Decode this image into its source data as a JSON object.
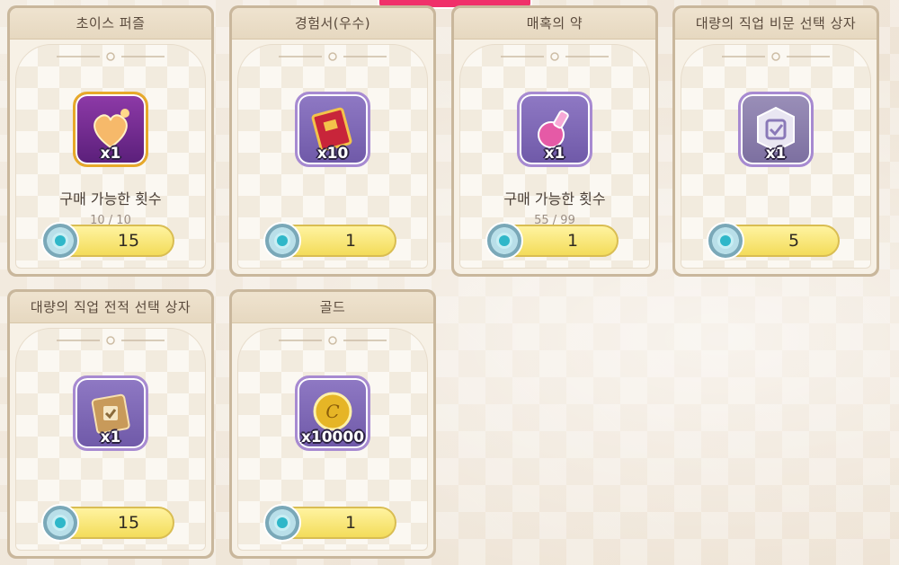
{
  "cards": [
    {
      "title": "초이스 퍼즐",
      "quantity": "x1",
      "limit_label": "구매 가능한 횟수",
      "limit_count": "10 / 10",
      "price": "15",
      "icon": "heart-puzzle-icon"
    },
    {
      "title": "경험서(우수)",
      "quantity": "x10",
      "limit_label": "",
      "limit_count": "",
      "price": "1",
      "icon": "red-book-icon"
    },
    {
      "title": "매혹의 약",
      "quantity": "x1",
      "limit_label": "구매 가능한 횟수",
      "limit_count": "55 / 99",
      "price": "1",
      "icon": "potion-icon"
    },
    {
      "title": "대량의 직업 비문 선택 상자",
      "quantity": "x1",
      "limit_label": "",
      "limit_count": "",
      "price": "5",
      "icon": "silver-box-icon"
    },
    {
      "title": "대량의 직업 전적 선택 상자",
      "quantity": "x1",
      "limit_label": "",
      "limit_count": "",
      "price": "15",
      "icon": "tome-box-icon"
    },
    {
      "title": "골드",
      "quantity": "x10000",
      "limit_label": "",
      "limit_count": "",
      "price": "1",
      "icon": "gold-coin-icon"
    }
  ],
  "currency_icon": "cog-gem-icon",
  "colors": {
    "price_button": "#f3dc5a",
    "icon_frame": "#8f79c4",
    "accent_tab": "#f0306a"
  }
}
